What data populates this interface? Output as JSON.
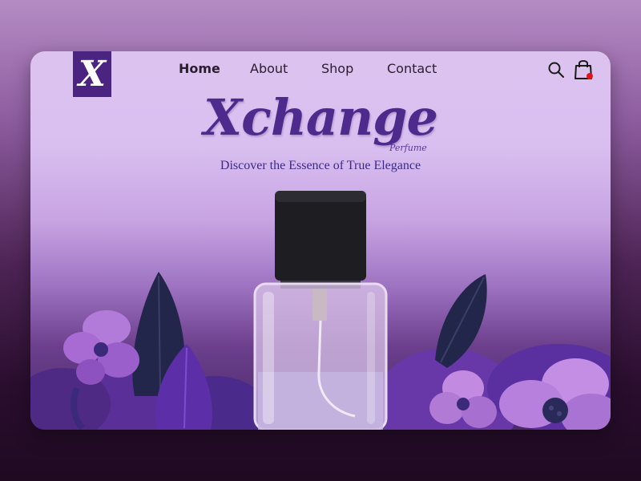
{
  "logo": {
    "letter": "X"
  },
  "nav": {
    "items": [
      {
        "label": "Home",
        "active": true
      },
      {
        "label": "About",
        "active": false
      },
      {
        "label": "Shop",
        "active": false
      },
      {
        "label": "Contact",
        "active": false
      }
    ]
  },
  "header_icons": [
    "search-icon",
    "shopping-bag-icon"
  ],
  "cart": {
    "has_notification": true,
    "notification_color": "#e0141a"
  },
  "hero": {
    "brand": "Xchange",
    "brand_sub": "Perfume",
    "tagline": "Discover the Essence of True Elegance"
  },
  "colors": {
    "accent": "#4b2482",
    "brand_text": "#4d2a8c",
    "card_top": "#dcc3ef",
    "page_bottom": "#1f0a22"
  }
}
